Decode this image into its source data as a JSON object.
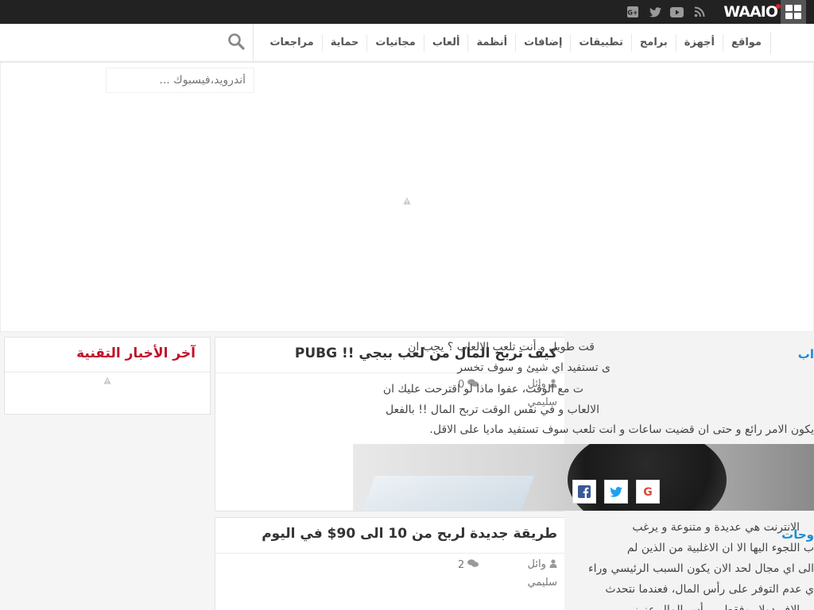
{
  "topbar": {
    "logo_text": "WAAIO",
    "social_icons": [
      "google-plus-square-icon",
      "twitter-icon",
      "youtube-icon",
      "rss-icon"
    ]
  },
  "nav": {
    "items": [
      "مواقع",
      "أجهزة",
      "برامج",
      "تطبيقات",
      "إضافات",
      "أنظمة",
      "ألعاب",
      "مجانيات",
      "حماية",
      "مراجعات"
    ]
  },
  "search": {
    "placeholder": "أندرويد،فيسبوك ..."
  },
  "sidebar": {
    "title": "آخر الأخبار التقنية"
  },
  "articles": [
    {
      "title": "كيف تربح المال من لعب ببجي !! PUBG",
      "author": "وائل سليمي",
      "comments": "0",
      "excerpt_lines": [
        "قت طويل و أنت تلعب الالعاب ؟ يجب ان",
        "ى تستفيد اي شيئ و سوف تخسر",
        "ت مع الوقت، عفوا ماذا لو اقترحت عليك ان",
        "الالعاب و في نفس الوقت تربح المال !! بالفعل",
        "يكون الامر رائع و حتى ان قضيت ساعات و انت تلعب سوف تستفيد ماديا على الاقل."
      ]
    },
    {
      "title": "طريقة جديدة لربح من 10 الى 90$ في اليوم",
      "author": "وائل سليمي",
      "comments": "2",
      "excerpt_lines": [
        "الانترنت هي عديدة و متنوعة و يرغب",
        "ب اللجوء اليها الا ان الاغلبية من الذين لم",
        "الى اي مجال لحد الان يكون السبب الرئيسي وراء",
        "ي عدم التوفر على رأس المال، فعندما نتحدث",
        "... الإف دولار وفقط... رأس المال عزيز"
      ]
    }
  ],
  "edge_labels": [
    "اب",
    "وحات"
  ],
  "share": [
    "facebook-icon",
    "twitter-icon",
    "google-icon"
  ]
}
